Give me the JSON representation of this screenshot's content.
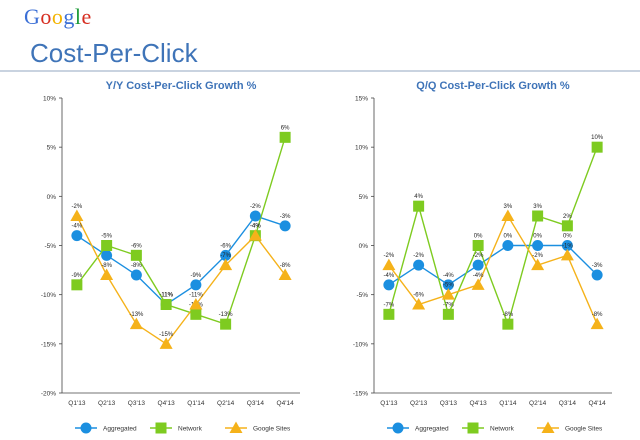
{
  "header": {
    "logo_text": "Google",
    "logo_colors": [
      "#3b6fd6",
      "#d62d20",
      "#f3b400",
      "#3b6fd6",
      "#1f9b3a",
      "#d62d20"
    ],
    "title": "Cost-Per-Click",
    "title_color": "#3f74b8"
  },
  "colors": {
    "Aggregated": "#1b8fe0",
    "Network": "#7ecb20",
    "Google Sites": "#f5b21a"
  },
  "chart_data": [
    {
      "type": "line",
      "title": "Y/Y Cost-Per-Click Growth %",
      "categories": [
        "Q1'13",
        "Q2'13",
        "Q3'13",
        "Q4'13",
        "Q1'14",
        "Q2'14",
        "Q3'14",
        "Q4'14"
      ],
      "ylim": [
        -20,
        10
      ],
      "yticks": [
        -20,
        -15,
        -10,
        -5,
        0,
        5,
        10
      ],
      "ytick_labels": [
        "-20%",
        "-15%",
        "-10%",
        "-5%",
        "0%",
        "5%",
        "10%"
      ],
      "grid": false,
      "legend_position": "bottom",
      "series": [
        {
          "name": "Aggregated",
          "marker": "circle",
          "values": [
            -4,
            -6,
            -8,
            -11,
            -9,
            -6,
            -2,
            -3
          ],
          "labels": [
            "-4%",
            "-6%",
            "-8%",
            "-11%",
            "-9%",
            "-6%",
            "-2%",
            "-3%"
          ]
        },
        {
          "name": "Network",
          "marker": "square",
          "values": [
            -9,
            -5,
            -6,
            -11,
            -12,
            -13,
            -4,
            6
          ],
          "labels": [
            "-9%",
            "-5%",
            "-6%",
            "-11%",
            "-12%",
            "-13%",
            "-4%",
            "6%"
          ]
        },
        {
          "name": "Google Sites",
          "marker": "triangle",
          "values": [
            -2,
            -8,
            -13,
            -15,
            -11,
            -7,
            -4,
            -8
          ],
          "labels": [
            "-2%",
            "-8%",
            "-13%",
            "-15%",
            "-11%",
            "-7%",
            "-4%",
            "-8%"
          ]
        }
      ]
    },
    {
      "type": "line",
      "title": "Q/Q Cost-Per-Click Growth %",
      "categories": [
        "Q1'13",
        "Q2'13",
        "Q3'13",
        "Q4'13",
        "Q1'14",
        "Q2'14",
        "Q3'14",
        "Q4'14"
      ],
      "ylim": [
        -15,
        15
      ],
      "yticks": [
        -15,
        -10,
        -5,
        0,
        5,
        10,
        15
      ],
      "ytick_labels": [
        "-15%",
        "-10%",
        "-5%",
        "0%",
        "5%",
        "10%",
        "15%"
      ],
      "grid": false,
      "legend_position": "bottom",
      "series": [
        {
          "name": "Aggregated",
          "marker": "circle",
          "values": [
            -4,
            -2,
            -4,
            -2,
            0,
            0,
            0,
            -3
          ],
          "labels": [
            "-4%",
            "-2%",
            "-4%",
            "-2%",
            "0%",
            "0%",
            "0%",
            "-3%"
          ]
        },
        {
          "name": "Network",
          "marker": "square",
          "values": [
            -7,
            4,
            -7,
            0,
            -8,
            3,
            2,
            10
          ],
          "labels": [
            "-7%",
            "4%",
            "-7%",
            "0%",
            "-8%",
            "3%",
            "2%",
            "10%"
          ]
        },
        {
          "name": "Google Sites",
          "marker": "triangle",
          "values": [
            -2,
            -6,
            -5,
            -4,
            3,
            -2,
            -1,
            -8
          ],
          "labels": [
            "-2%",
            "-6%",
            "-5%",
            "-4%",
            "3%",
            "-2%",
            "-1%",
            "-8%"
          ]
        }
      ]
    }
  ]
}
